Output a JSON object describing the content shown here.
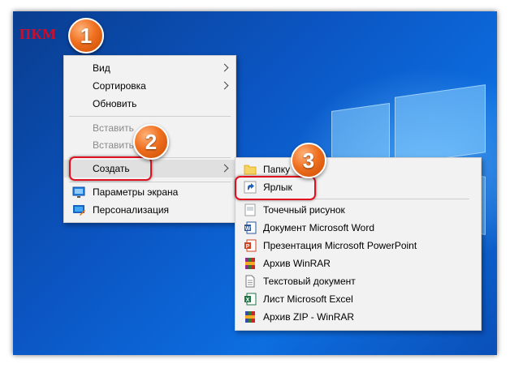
{
  "annotation": {
    "pkm_label": "ПКМ",
    "step1": "1",
    "step2": "2",
    "step3": "3"
  },
  "context_menu": {
    "items": [
      {
        "label": "Вид",
        "submenu": true,
        "disabled": false
      },
      {
        "label": "Сортировка",
        "submenu": true,
        "disabled": false
      },
      {
        "label": "Обновить",
        "submenu": false,
        "disabled": false
      },
      {
        "label": "Вставить",
        "submenu": false,
        "disabled": true
      },
      {
        "label": "Вставить",
        "submenu": false,
        "disabled": true
      },
      {
        "label": "Создать",
        "submenu": true,
        "disabled": false
      },
      {
        "label": "Параметры экрана",
        "icon": "display-settings-icon"
      },
      {
        "label": "Персонализация",
        "icon": "personalization-icon"
      }
    ]
  },
  "create_submenu": {
    "items": [
      {
        "label": "Папку",
        "icon": "folder-icon"
      },
      {
        "label": "Ярлык",
        "icon": "shortcut-icon"
      },
      {
        "label": "Точечный рисунок",
        "icon": "bitmap-icon"
      },
      {
        "label": "Документ Microsoft Word",
        "icon": "word-icon"
      },
      {
        "label": "Презентация Microsoft PowerPoint",
        "icon": "powerpoint-icon"
      },
      {
        "label": "Архив WinRAR",
        "icon": "winrar-icon"
      },
      {
        "label": "Текстовый документ",
        "icon": "text-document-icon"
      },
      {
        "label": "Лист Microsoft Excel",
        "icon": "excel-icon"
      },
      {
        "label": "Архив ZIP - WinRAR",
        "icon": "zip-winrar-icon"
      }
    ]
  },
  "colors": {
    "desktop": "#0b56c4",
    "annotation_red": "#e0101f",
    "badge_orange": "#f07020"
  }
}
